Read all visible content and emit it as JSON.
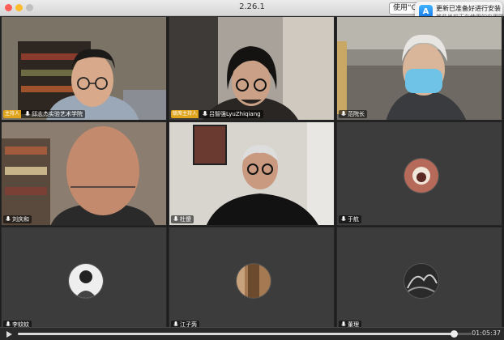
{
  "window": {
    "title": "2.26.1"
  },
  "toolbar": {
    "use_button": "使用“Q"
  },
  "notification": {
    "title": "更新已准备好进行安装",
    "body": "某些当前正在使用的应用阻止",
    "icon": "app-store-icon"
  },
  "participants": [
    {
      "name": "邱志杰实验艺术学院",
      "host_tag": "主持人",
      "video": true
    },
    {
      "name": "吕智强LyuZhiqiang",
      "host_tag": "联席主持人",
      "video": true
    },
    {
      "name": "范院长",
      "host_tag": "",
      "video": true
    },
    {
      "name": "刘庆和",
      "host_tag": "",
      "video": true
    },
    {
      "name": "杜傻",
      "host_tag": "",
      "video": true
    },
    {
      "name": "于航",
      "host_tag": "",
      "video": false
    },
    {
      "name": "李蚊蚊",
      "host_tag": "",
      "video": false
    },
    {
      "name": "江子蒟",
      "host_tag": "",
      "video": false
    },
    {
      "name": "董理",
      "host_tag": "",
      "video": false
    }
  ],
  "playback": {
    "time": "01:05:37",
    "progress": 0.96
  },
  "colors": {
    "host_tag": "#e0a31c",
    "tile_bg": "#3c3c3c",
    "progress_fill": "#d9d9d9"
  }
}
